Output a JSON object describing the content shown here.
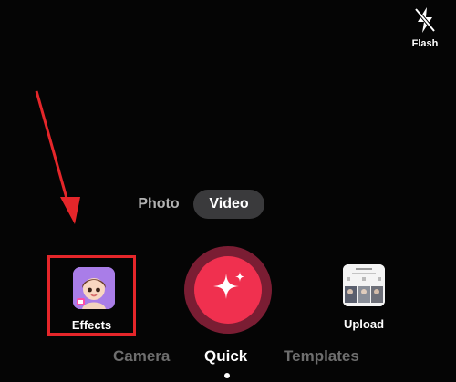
{
  "flash": {
    "label": "Flash",
    "icon": "flash-off-icon"
  },
  "modes": {
    "photo": "Photo",
    "video": "Video",
    "selected": "Video"
  },
  "effects": {
    "label": "Effects",
    "icon": "avatar-effect-icon"
  },
  "record": {
    "icon": "sparkle-icon"
  },
  "upload": {
    "label": "Upload",
    "icon": "gallery-thumbnail"
  },
  "tabs": [
    {
      "label": "Camera",
      "active": false
    },
    {
      "label": "Quick",
      "active": true
    },
    {
      "label": "Templates",
      "active": false
    }
  ],
  "colors": {
    "record_outer": "#7a1d33",
    "record_inner": "#f0304f",
    "highlight": "#e5262a",
    "toggle_bg": "#3a3a3c"
  }
}
